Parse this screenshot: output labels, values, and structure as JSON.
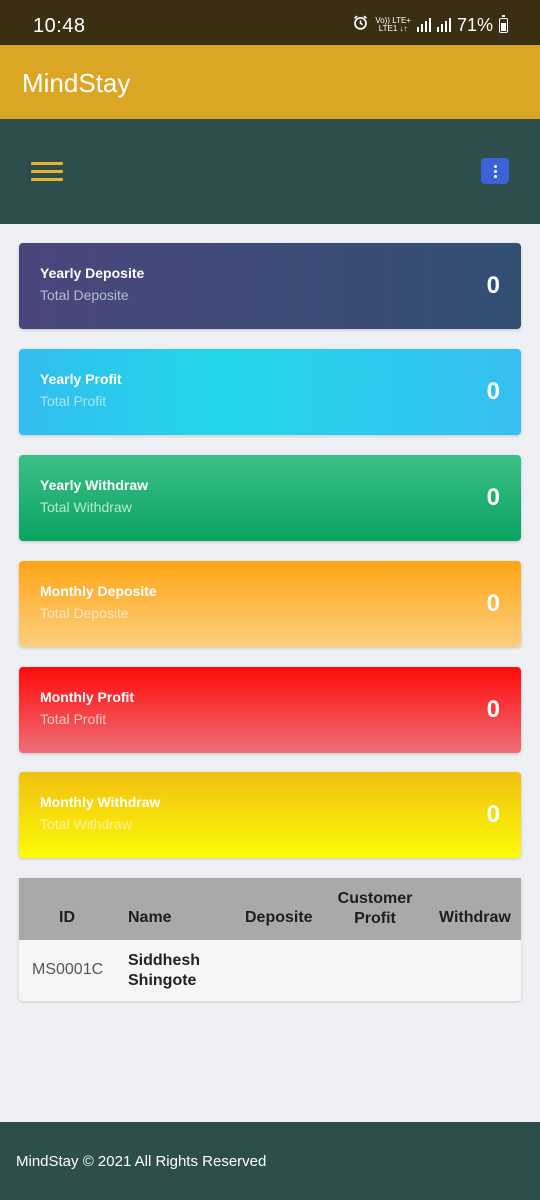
{
  "status_bar": {
    "time": "10:48",
    "network_top": "Vo)) LTE+",
    "network_bottom": "LTE1 ↓↑",
    "battery": "71%"
  },
  "app": {
    "title": "MindStay"
  },
  "cards": [
    {
      "label": "Yearly Deposite",
      "sublabel": "Total Deposite",
      "value": "0"
    },
    {
      "label": "Yearly Profit",
      "sublabel": "Total Profit",
      "value": "0"
    },
    {
      "label": "Yearly Withdraw",
      "sublabel": "Total Withdraw",
      "value": "0"
    },
    {
      "label": "Monthly Deposite",
      "sublabel": "Total Deposite",
      "value": "0"
    },
    {
      "label": "Monthly Profit",
      "sublabel": "Total Profit",
      "value": "0"
    },
    {
      "label": "Monthly Withdraw",
      "sublabel": "Total Withdraw",
      "value": "0"
    }
  ],
  "table": {
    "headers": [
      "ID",
      "Name",
      "Deposite",
      "Customer\nProfit",
      "Withdraw"
    ],
    "rows": [
      {
        "id": "MS0001C",
        "name": "Siddhesh\nShingote",
        "deposite": "",
        "customer_profit": "",
        "withdraw": ""
      }
    ]
  },
  "footer": {
    "text": "MindStay © 2021 All Rights Reserved"
  },
  "icons": [
    "alarm-icon",
    "signal-icon",
    "battery-icon",
    "hamburger-menu-icon",
    "kebab-menu-icon"
  ]
}
